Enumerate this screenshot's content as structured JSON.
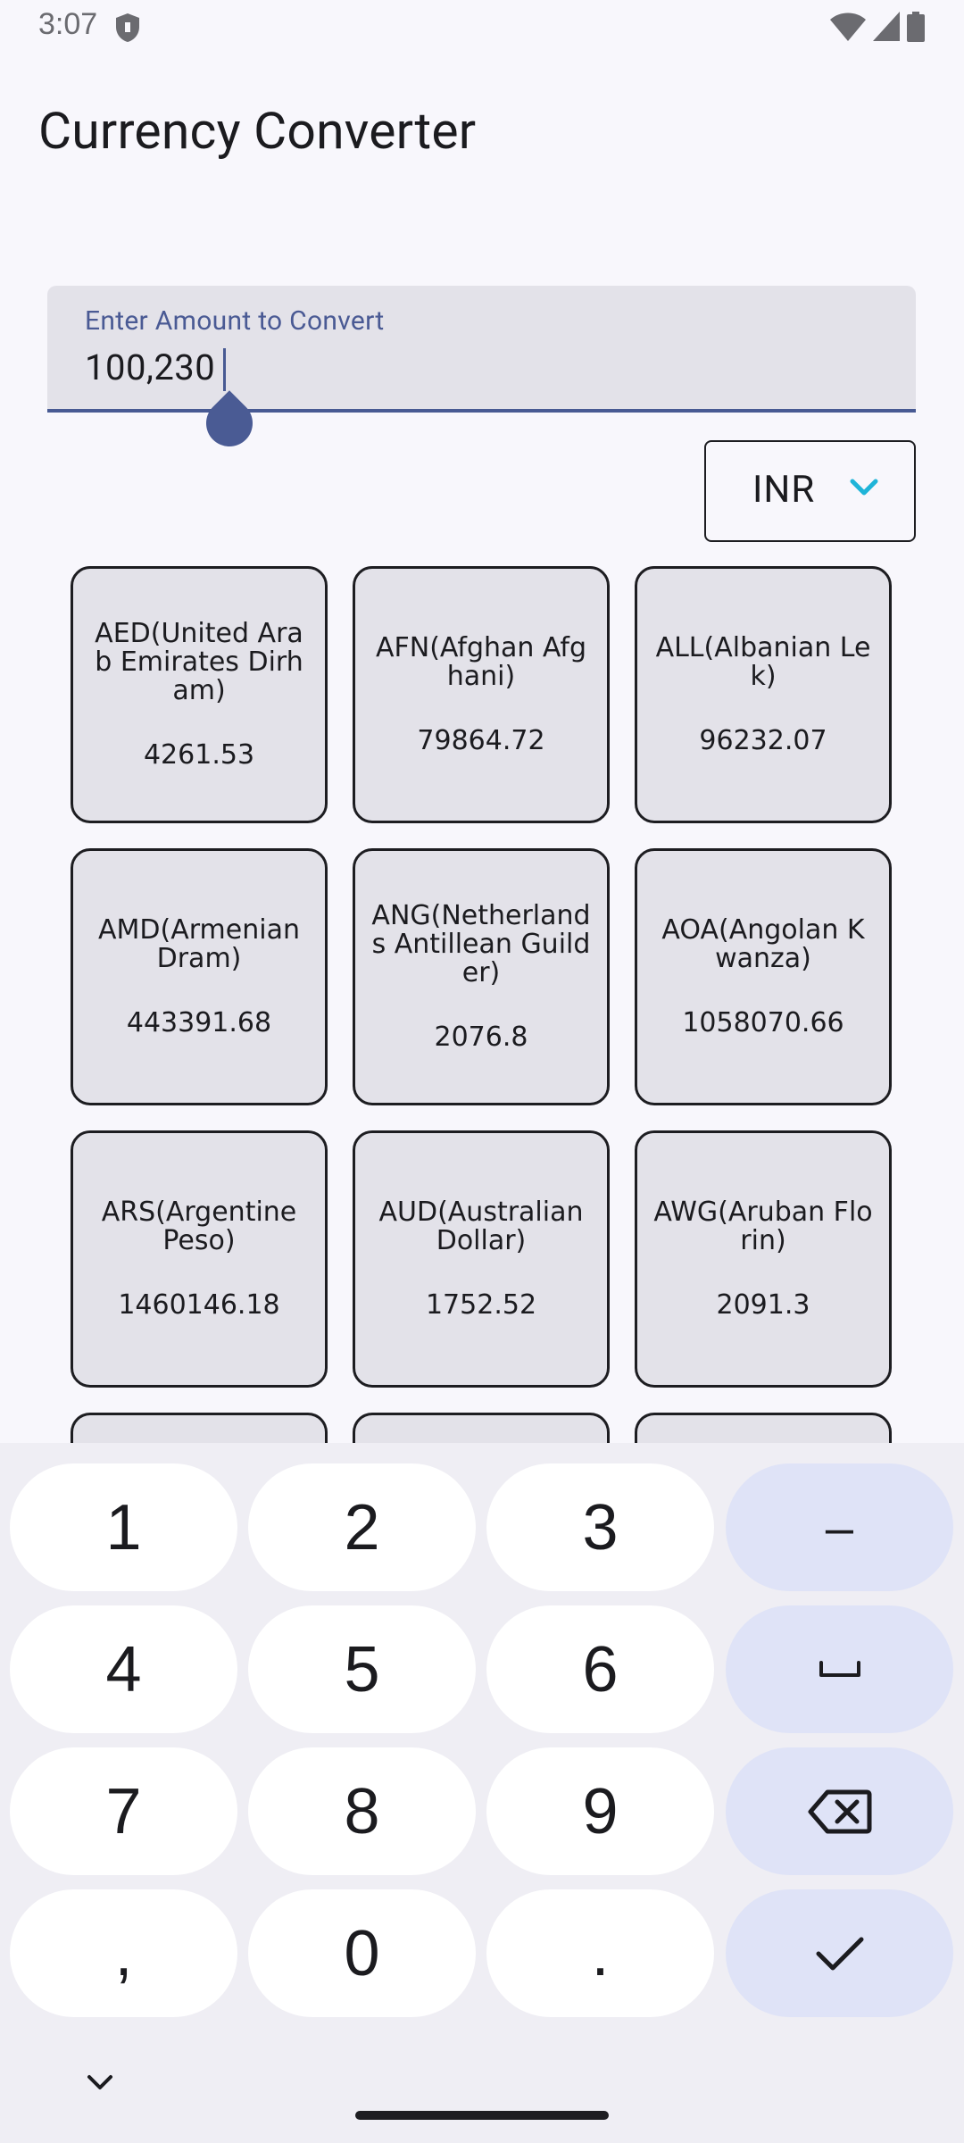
{
  "status_bar": {
    "time": "3:07"
  },
  "app": {
    "title": "Currency Converter"
  },
  "amount_field": {
    "label": "Enter Amount to Convert",
    "value": "100,230"
  },
  "currency_select": {
    "value": "INR"
  },
  "cards": [
    {
      "name": "AED(United Arab Emirates Dirham)",
      "value": "4261.53"
    },
    {
      "name": "AFN(Afghan Afghani)",
      "value": "79864.72"
    },
    {
      "name": "ALL(Albanian Lek)",
      "value": "96232.07"
    },
    {
      "name": "AMD(Armenian Dram)",
      "value": "443391.68"
    },
    {
      "name": "ANG(Netherlands Antillean Guilder)",
      "value": "2076.8"
    },
    {
      "name": "AOA(Angolan Kwanza)",
      "value": "1058070.66"
    },
    {
      "name": "ARS(Argentine Peso)",
      "value": "1460146.18"
    },
    {
      "name": "AUD(Australian Dollar)",
      "value": "1752.52"
    },
    {
      "name": "AWG(Aruban Florin)",
      "value": "2091.3"
    }
  ],
  "keyboard": {
    "keys": [
      "1",
      "2",
      "3",
      "–",
      "4",
      "5",
      "6",
      "␣",
      "7",
      "8",
      "9",
      "⌫",
      ",",
      "0",
      ".",
      "✓"
    ]
  },
  "colors": {
    "background": "#f8f7fc",
    "field_bg": "#e3e2e9",
    "accent": "#485a93",
    "chevron": "#1fb4d8",
    "keyboard_bg": "#efeef4",
    "func_key": "#dfe3f7"
  }
}
